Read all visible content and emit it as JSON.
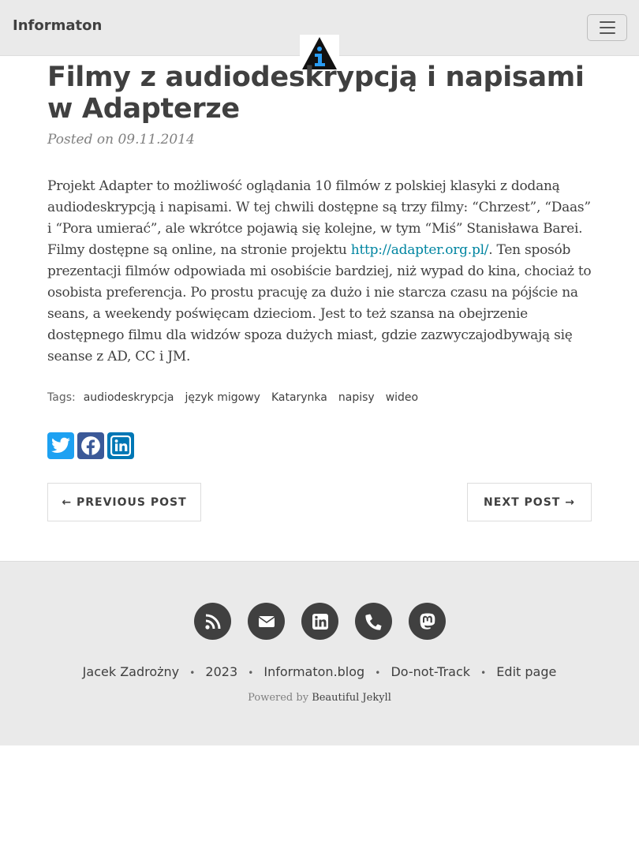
{
  "nav": {
    "brand": "Informaton",
    "menu_icon": "hamburger-icon"
  },
  "avatar": {
    "icon": "info-triangle-logo"
  },
  "post": {
    "title": "Filmy z audiodeskrypcją i napisami w Adapterze",
    "meta": "Posted on 09.11.2014",
    "body_before_link": "Projekt Adapter to możliwość oglądania 10 filmów z polskiej klasyki z dodaną audiodeskrypcją i napisami. W tej chwili dostępne są trzy filmy: “Chrzest”, “Daas” i “Pora umierać”, ale wkrótce pojawią się kolejne, w tym “Miś” Stanisława Barei. Filmy dostępne są online, na stronie projektu ",
    "link_text": "http://adapter.org.pl/",
    "body_after_link": ". Ten sposób prezentacji filmów odpowiada mi osobiście bardziej, niż wypad do kina, chociaż to osobista preferencja. Po prostu pracuję za dużo i nie starcza czasu na pójście na seans, a weekendy poświęcam dzieciom. Jest to też szansa na obejrzenie dostępnego filmu dla widzów spoza dużych miast, gdzie zazwyczajodbywają się seanse z AD, CC i JM."
  },
  "tags": {
    "label": "Tags:",
    "items": [
      "audiodeskrypcja",
      "język migowy",
      "Katarynka",
      "napisy",
      "wideo"
    ]
  },
  "share": {
    "twitter_color": "#1da1f2",
    "facebook_color": "#3b5998",
    "linkedin_color": "#0077b5"
  },
  "pager": {
    "previous": "← PREVIOUS POST",
    "next": "NEXT POST →"
  },
  "footer": {
    "social_icons": [
      "rss-icon",
      "email-icon",
      "linkedin-icon",
      "phone-icon",
      "mastodon-icon"
    ],
    "author": "Jacek Zadrożny",
    "year": "2023",
    "site": "Informaton.blog",
    "dnt": "Do-not-Track",
    "edit": "Edit page",
    "powered_prefix": "Powered by",
    "powered_link": "Beautiful Jekyll"
  }
}
